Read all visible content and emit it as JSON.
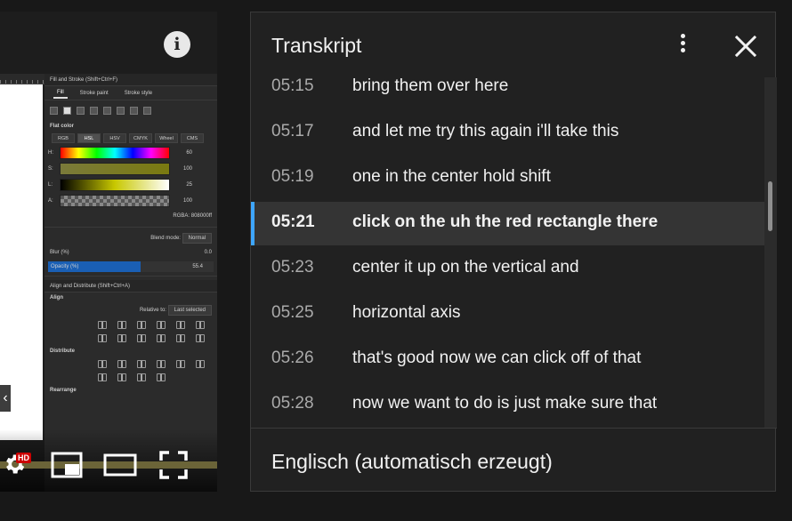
{
  "video": {
    "info_icon": "info-icon",
    "prev_icon": "chevron-left-icon",
    "prev_glyph": "‹",
    "settings_icon": "gear-icon",
    "hd_badge": "HD",
    "miniplayer_icon": "miniplayer-icon",
    "theater_icon": "theater-mode-icon",
    "fullscreen_icon": "fullscreen-icon",
    "editor": {
      "panel_title": "Fill and Stroke (Shift+Ctrl+F)",
      "tabs": [
        "Fill",
        "Stroke paint",
        "Stroke style"
      ],
      "flat_color": "Flat color",
      "color_modes": [
        "RGB",
        "HSL",
        "HSV",
        "CMYK",
        "Wheel",
        "CMS"
      ],
      "sliders": [
        {
          "label": "H:",
          "value": "60"
        },
        {
          "label": "S:",
          "value": "100"
        },
        {
          "label": "L:",
          "value": "25"
        },
        {
          "label": "A:",
          "value": "100"
        }
      ],
      "rgba_label": "RGBA:",
      "rgba_value": "808000ff",
      "blend_mode_label": "Blend mode:",
      "blend_mode_value": "Normal",
      "blur_label": "Blur (%)",
      "blur_value": "0.0",
      "opacity_label": "Opacity (%)",
      "opacity_value": "55.4",
      "align_title": "Align and Distribute (Shift+Ctrl+A)",
      "align_label": "Align",
      "relative_to_label": "Relative to:",
      "relative_to_value": "Last selected",
      "distribute_label": "Distribute",
      "rearrange_label": "Rearrange"
    }
  },
  "transcript": {
    "title": "Transkript",
    "more_icon": "more-vert-icon",
    "close_icon": "close-icon",
    "segments": [
      {
        "time": "05:15",
        "text": "bring them over here",
        "active": false
      },
      {
        "time": "05:17",
        "text": "and let me try this again i'll take this",
        "active": false
      },
      {
        "time": "05:19",
        "text": "one in the center hold shift",
        "active": false
      },
      {
        "time": "05:21",
        "text": "click on the uh the red rectangle there",
        "active": true
      },
      {
        "time": "05:23",
        "text": "center it up on the vertical and",
        "active": false
      },
      {
        "time": "05:25",
        "text": "horizontal axis",
        "active": false
      },
      {
        "time": "05:26",
        "text": "that's good now we can click off of that",
        "active": false
      },
      {
        "time": "05:28",
        "text": "now we want to do is just make sure that",
        "active": false
      }
    ],
    "language": "Englisch (automatisch erzeugt)",
    "active_color": "#3ea6ff"
  }
}
